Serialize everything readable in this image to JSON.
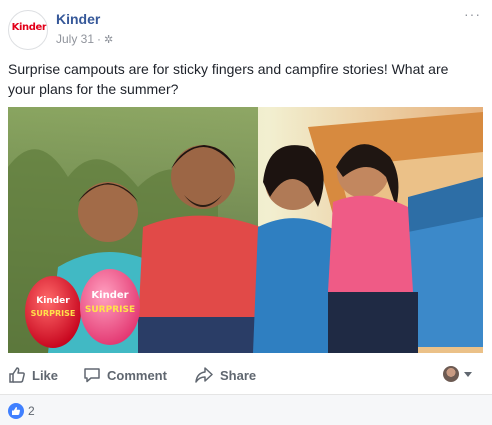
{
  "page": {
    "name": "Kinder",
    "logo_text": "Kinder",
    "date": "July 31",
    "separator": "·",
    "privacy_icon": "gear-icon",
    "more_icon": "more-options-icon"
  },
  "post": {
    "caption": "Surprise campouts are for sticky fingers and campfire stories! What are your plans for the summer?",
    "photo_egg_brand": "Kinder",
    "photo_egg_product": "SURPRISE"
  },
  "actions": {
    "like": "Like",
    "comment": "Comment",
    "share": "Share"
  },
  "reactions": {
    "count": "2",
    "icon": "like-thumb-icon"
  },
  "colors": {
    "link": "#365899",
    "meta": "#90949c",
    "action": "#606770",
    "like_blue": "#4080ff",
    "brand_red": "#e2001a"
  }
}
